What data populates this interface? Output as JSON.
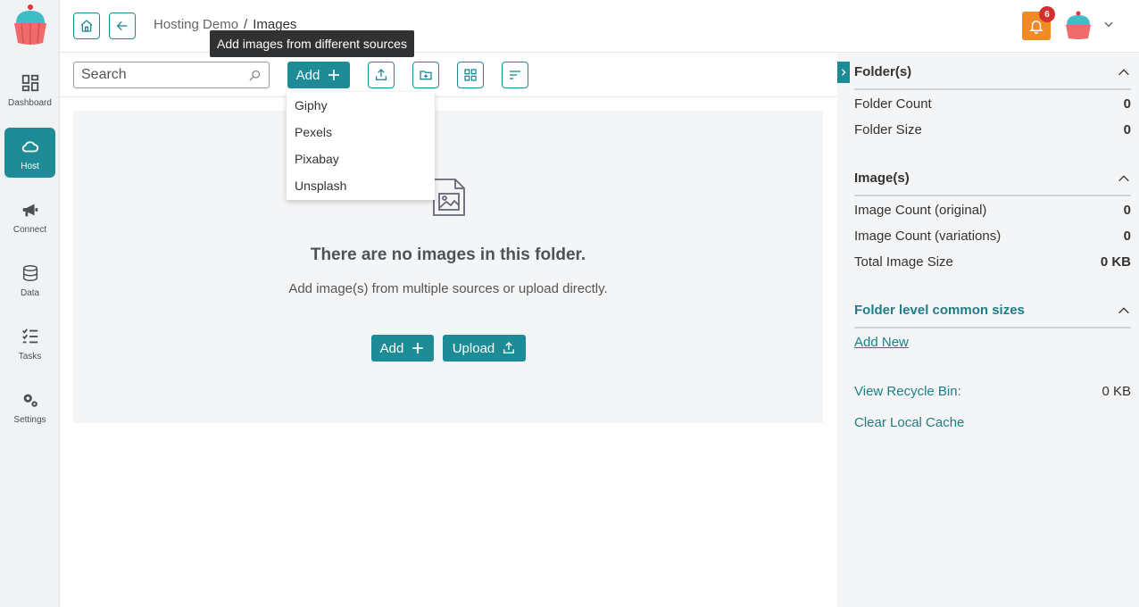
{
  "nav": {
    "items": [
      {
        "label": "Dashboard",
        "icon": "dashboard-icon"
      },
      {
        "label": "Host",
        "icon": "cloud-icon",
        "active": true
      },
      {
        "label": "Connect",
        "icon": "megaphone-icon"
      },
      {
        "label": "Data",
        "icon": "database-icon"
      },
      {
        "label": "Tasks",
        "icon": "tasks-icon"
      },
      {
        "label": "Settings",
        "icon": "gear-icon"
      }
    ]
  },
  "header": {
    "breadcrumb": {
      "parent": "Hosting Demo",
      "separator": "/",
      "current": "Images"
    },
    "notification_count": "6"
  },
  "tooltip": {
    "text": "Add images from different sources"
  },
  "toolbar": {
    "search_placeholder": "Search",
    "add_label": "Add"
  },
  "add_menu": {
    "items": [
      "Giphy",
      "Pexels",
      "Pixabay",
      "Unsplash"
    ]
  },
  "empty_state": {
    "title": "There are no images in this folder.",
    "subtitle": "Add image(s) from multiple sources or upload directly.",
    "add_label": "Add",
    "upload_label": "Upload"
  },
  "panel": {
    "folders": {
      "title": "Folder(s)",
      "rows": [
        {
          "label": "Folder Count",
          "value": "0"
        },
        {
          "label": "Folder Size",
          "value": "0"
        }
      ]
    },
    "images": {
      "title": "Image(s)",
      "rows": [
        {
          "label": "Image Count (original)",
          "value": "0"
        },
        {
          "label": "Image Count (variations)",
          "value": "0"
        },
        {
          "label": "Total Image Size",
          "value": "0 KB"
        }
      ]
    },
    "common_sizes": {
      "title": "Folder level common sizes",
      "add_new": "Add New"
    },
    "recycle_bin": {
      "label": "View Recycle Bin:",
      "value": "0 KB"
    },
    "clear_cache": "Clear Local Cache"
  },
  "colors": {
    "accent": "#1e8c96",
    "notification": "#f08a24",
    "badge": "#d32f2f"
  }
}
